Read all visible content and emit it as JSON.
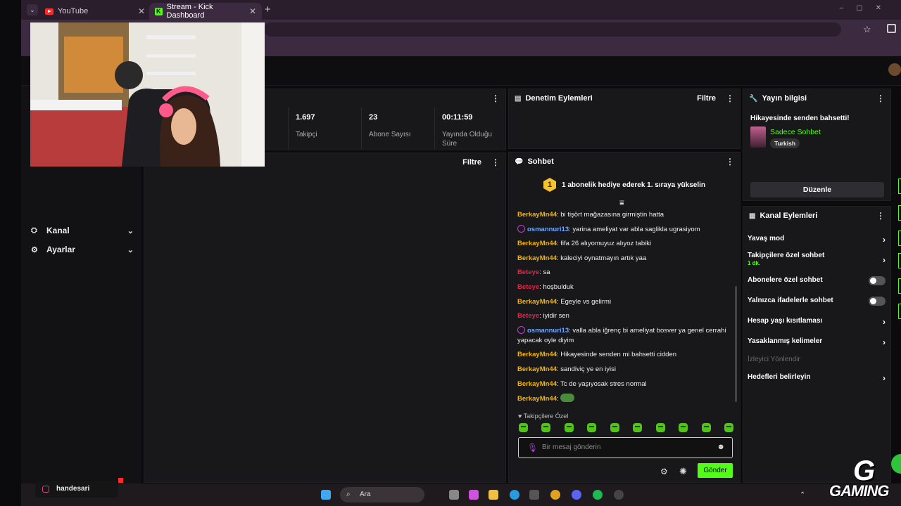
{
  "browser": {
    "tabs": [
      {
        "label": "YouTube"
      },
      {
        "label": "Stream - Kick Dashboard"
      }
    ],
    "new_tab": "+"
  },
  "sidebar": {
    "items": [
      {
        "label": "Kanal",
        "icon": "channel-icon"
      },
      {
        "label": "Ayarlar",
        "icon": "gear-icon"
      }
    ]
  },
  "stats": {
    "items": [
      {
        "value": "1.697",
        "label": "Takipçi"
      },
      {
        "value": "23",
        "label": "Abone Sayısı"
      },
      {
        "value": "00:11:59",
        "label": "Yayında Olduğu Süre"
      }
    ]
  },
  "activity": {
    "filter_label": "Filtre"
  },
  "moderation": {
    "title": "Denetim Eylemleri",
    "filter_label": "Filtre"
  },
  "chat": {
    "title": "Sohbet",
    "pinned_rank": "1",
    "pinned_text": "1 abonelik hediye ederek 1. sıraya yükselin",
    "messages": [
      {
        "user": "BerkayMn44",
        "color": "#f4b400",
        "text": "bi tişört mağazasına girmiştin hatta",
        "badge": false
      },
      {
        "user": "osmannuri13",
        "color": "#6fa8ff",
        "text": "yarina ameliyat var abla saglikla ugrasiyom",
        "badge": true
      },
      {
        "user": "BerkayMn44",
        "color": "#f4b400",
        "text": "fifa 26 alıyomuyuz alıyoz tabiki",
        "badge": false
      },
      {
        "user": "BerkayMn44",
        "color": "#f4b400",
        "text": "kaleciyi oynatmayın artık yaa",
        "badge": false
      },
      {
        "user": "Beteye",
        "color": "#e0244a",
        "text": "sa",
        "badge": false
      },
      {
        "user": "Beteye",
        "color": "#e0244a",
        "text": "hoşbulduk",
        "badge": false
      },
      {
        "user": "BerkayMn44",
        "color": "#f4b400",
        "text": "Egeyle vs gelirmi",
        "badge": false
      },
      {
        "user": "Beteye",
        "color": "#e0244a",
        "text": "iyidir sen",
        "badge": false
      },
      {
        "user": "osmannuri13",
        "color": "#6fa8ff",
        "text": "valla abla iğrenç bi ameliyat bosver ya genel cerrahi yapacak oyle diyim",
        "badge": true
      },
      {
        "user": "BerkayMn44",
        "color": "#f4b400",
        "text": "Hikayesinde senden mi bahsetti cidden",
        "badge": false
      },
      {
        "user": "BerkayMn44",
        "color": "#f4b400",
        "text": "sandiviç ye en iyisi",
        "badge": false
      },
      {
        "user": "BerkayMn44",
        "color": "#f4b400",
        "text": "Tc de yaşıyosak stres normal",
        "badge": false
      },
      {
        "user": "BerkayMn44",
        "color": "#f4b400",
        "text": "",
        "badge": false,
        "emote": true
      }
    ],
    "followers_label": "♥ Takipçilere Özel",
    "input_placeholder": "Bir mesaj gönderin",
    "send_label": "Gönder"
  },
  "stream_info": {
    "title": "Yayın bilgisi",
    "stream_title": "Hikayesinde senden bahsetti!",
    "category": "Sadece Sohbet",
    "language": "Turkish",
    "edit_label": "Düzenle"
  },
  "channel_actions": {
    "title": "Kanal Eylemleri",
    "items": [
      {
        "label": "Yavaş mod",
        "type": "chevron"
      },
      {
        "label": "Takipçilere özel sohbet",
        "sub": "1 dk.",
        "type": "chevron"
      },
      {
        "label": "Abonelere özel sohbet",
        "type": "toggle",
        "on": false
      },
      {
        "label": "Yalnızca ifadelerle sohbet",
        "type": "toggle",
        "on": false
      },
      {
        "label": "Hesap yaşı kısıtlaması",
        "type": "chevron"
      },
      {
        "label": "Yasaklanmış kelimeler",
        "type": "chevron"
      },
      {
        "label": "İzleyici Yönlendir",
        "type": "disabled"
      },
      {
        "label": "Hedefleri belirleyin",
        "type": "chevron"
      }
    ]
  },
  "taskbar": {
    "search_label": "Ara",
    "instagram_handle": "handesari"
  },
  "overlay": {
    "logo_text": "GAMING",
    "logo_letter": "G"
  },
  "colors": {
    "accent": "#53fc18",
    "chrome": "#3b2a40"
  }
}
